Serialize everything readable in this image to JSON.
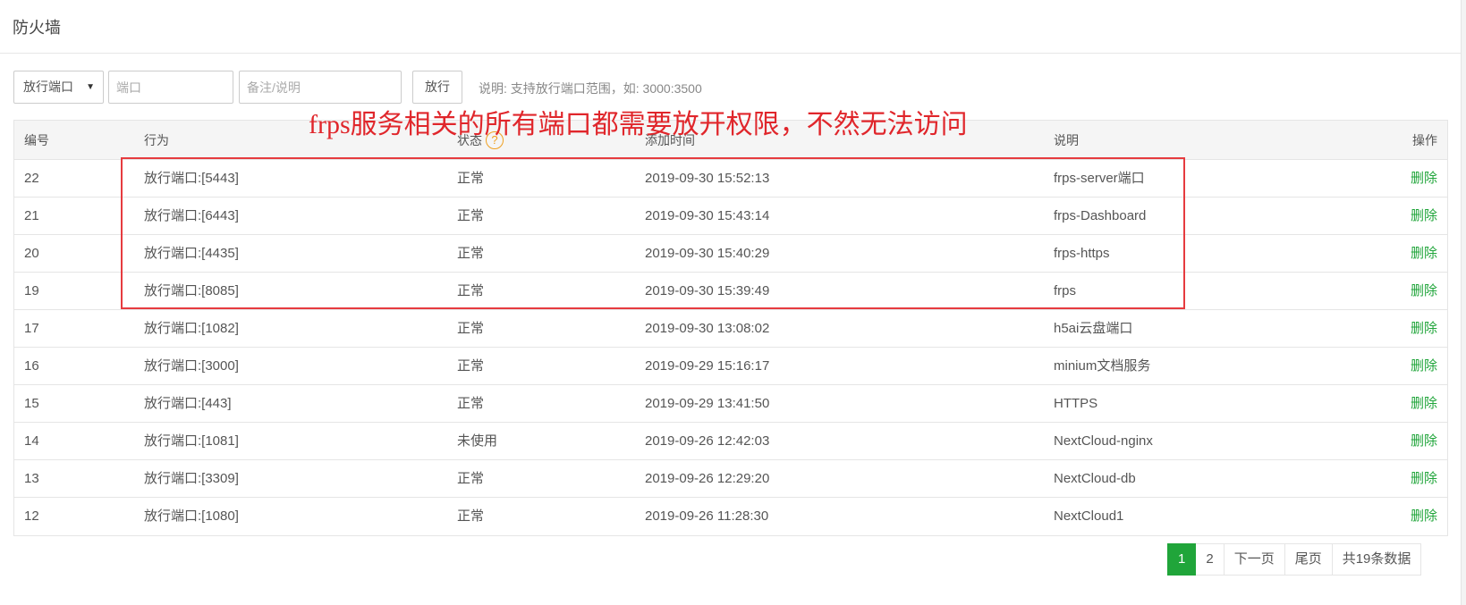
{
  "page": {
    "title": "防火墙"
  },
  "toolbar": {
    "select_value": "放行端口",
    "port_placeholder": "端口",
    "note_placeholder": "备注/说明",
    "submit_label": "放行",
    "hint": "说明: 支持放行端口范围，如: 3000:3500"
  },
  "annotation": "frps服务相关的所有端口都需要放开权限，不然无法访问",
  "table": {
    "headers": {
      "id": "编号",
      "action": "行为",
      "status": "状态",
      "time": "添加时间",
      "note": "说明",
      "op": "操作"
    },
    "status_help_icon": "question-circle-icon",
    "delete_label": "删除",
    "rows": [
      {
        "id": "22",
        "action": "放行端口:[5443]",
        "status": "正常",
        "time": "2019-09-30 15:52:13",
        "note": "frps-server端口"
      },
      {
        "id": "21",
        "action": "放行端口:[6443]",
        "status": "正常",
        "time": "2019-09-30 15:43:14",
        "note": "frps-Dashboard"
      },
      {
        "id": "20",
        "action": "放行端口:[4435]",
        "status": "正常",
        "time": "2019-09-30 15:40:29",
        "note": "frps-https"
      },
      {
        "id": "19",
        "action": "放行端口:[8085]",
        "status": "正常",
        "time": "2019-09-30 15:39:49",
        "note": "frps"
      },
      {
        "id": "17",
        "action": "放行端口:[1082]",
        "status": "正常",
        "time": "2019-09-30 13:08:02",
        "note": "h5ai云盘端口"
      },
      {
        "id": "16",
        "action": "放行端口:[3000]",
        "status": "正常",
        "time": "2019-09-29 15:16:17",
        "note": "minium文档服务"
      },
      {
        "id": "15",
        "action": "放行端口:[443]",
        "status": "正常",
        "time": "2019-09-29 13:41:50",
        "note": "HTTPS"
      },
      {
        "id": "14",
        "action": "放行端口:[1081]",
        "status": "未使用",
        "time": "2019-09-26 12:42:03",
        "note": "NextCloud-nginx"
      },
      {
        "id": "13",
        "action": "放行端口:[3309]",
        "status": "正常",
        "time": "2019-09-26 12:29:20",
        "note": "NextCloud-db"
      },
      {
        "id": "12",
        "action": "放行端口:[1080]",
        "status": "正常",
        "time": "2019-09-26 11:28:30",
        "note": "NextCloud1"
      }
    ]
  },
  "pagination": {
    "pages": [
      "1",
      "2"
    ],
    "current": "1",
    "next_label": "下一页",
    "last_label": "尾页",
    "total_label": "共19条数据"
  },
  "colors": {
    "accent": "#20a53a",
    "annotation": "#e0262b",
    "help_icon": "#f0a020"
  }
}
